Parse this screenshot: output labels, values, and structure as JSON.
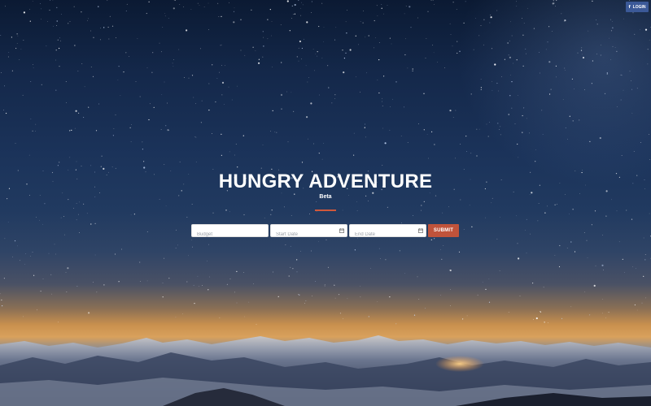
{
  "header": {
    "login_icon": "f",
    "login_label": "LOGIN",
    "brand_color": "#3b5998"
  },
  "hero": {
    "title": "HUNGRY ADVENTURE",
    "subtitle": "Beta",
    "accent_color": "#d0583b"
  },
  "form": {
    "budget": {
      "placeholder": "Budget",
      "value": ""
    },
    "start_date": {
      "placeholder": "Start Date",
      "value": "",
      "icon": "calendar-icon"
    },
    "end_date": {
      "placeholder": "End Date",
      "value": "",
      "icon": "calendar-icon"
    },
    "submit_label": "SUBMIT",
    "submit_color": "#c0533b"
  },
  "background": {
    "description_icon": "starry-night-mountains-image"
  }
}
